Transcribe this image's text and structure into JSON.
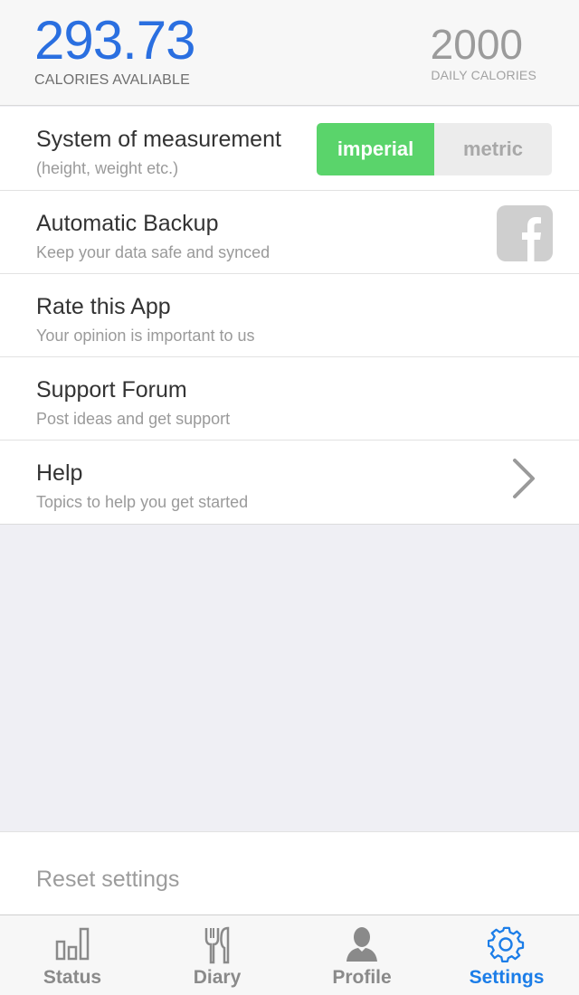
{
  "header": {
    "calories_available_value": "293.73",
    "calories_available_label": "CALORIES AVALIABLE",
    "daily_calories_value": "2000",
    "daily_calories_label": "DAILY CALORIES"
  },
  "settings": {
    "measurement": {
      "title": "System of measurement",
      "subtitle": "(height, weight etc.)",
      "options": [
        "imperial",
        "metric"
      ],
      "selected": "imperial"
    },
    "backup": {
      "title": "Automatic Backup",
      "subtitle": "Keep your data safe and synced",
      "icon": "facebook-icon"
    },
    "rate": {
      "title": "Rate this App",
      "subtitle": "Your opinion is important to us"
    },
    "forum": {
      "title": "Support Forum",
      "subtitle": "Post ideas and get support"
    },
    "help": {
      "title": "Help",
      "subtitle": "Topics to help you get started",
      "icon": "chevron-right-icon"
    },
    "reset_label": "Reset settings"
  },
  "tabbar": {
    "tabs": [
      {
        "label": "Status",
        "icon": "bar-chart-icon"
      },
      {
        "label": "Diary",
        "icon": "fork-knife-icon"
      },
      {
        "label": "Profile",
        "icon": "user-icon"
      },
      {
        "label": "Settings",
        "icon": "gear-icon"
      }
    ],
    "active": "Settings"
  },
  "colors": {
    "accent_blue": "#2a6fe0",
    "tab_active": "#1b7de8",
    "toggle_active": "#5ad46b"
  }
}
